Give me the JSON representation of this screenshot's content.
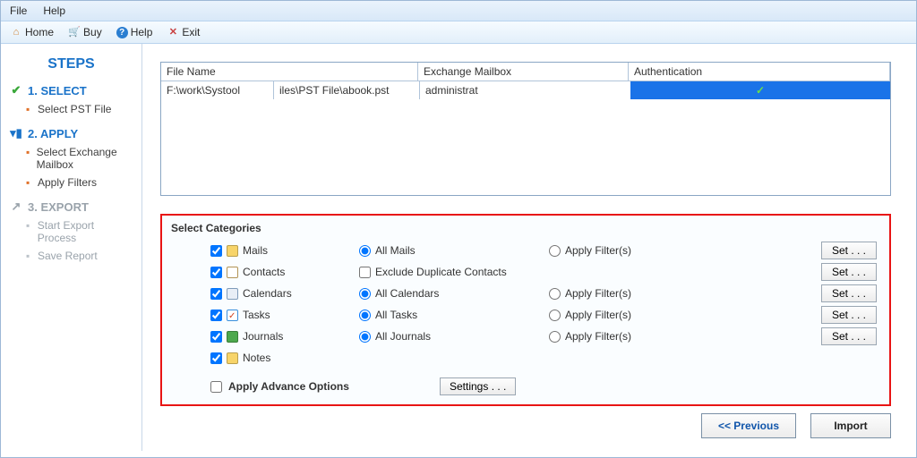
{
  "menu": {
    "file": "File",
    "help": "Help"
  },
  "toolbar": {
    "home": "Home",
    "buy": "Buy",
    "help": "Help",
    "exit": "Exit"
  },
  "sidebar": {
    "title": "STEPS",
    "step1": {
      "heading": "1. SELECT",
      "sub1": "Select PST File"
    },
    "step2": {
      "heading": "2. APPLY",
      "sub1": "Select Exchange Mailbox",
      "sub2": "Apply Filters"
    },
    "step3": {
      "heading": "3. EXPORT",
      "sub1": "Start Export Process",
      "sub2": "Save Report"
    }
  },
  "table": {
    "headers": {
      "filename": "File Name",
      "mailbox": "Exchange Mailbox",
      "auth": "Authentication"
    },
    "rows": [
      {
        "path_a": "F:\\work\\Systool",
        "path_b": "iles\\PST File\\abook.pst",
        "mailbox": "administrat",
        "auth_ok": "✓"
      }
    ]
  },
  "categories": {
    "title": "Select Categories",
    "items": {
      "mails": {
        "label": "Mails",
        "opt_all": "All Mails",
        "opt_filter": "Apply Filter(s)"
      },
      "contacts": {
        "label": "Contacts",
        "opt_exclude": "Exclude Duplicate Contacts"
      },
      "calendars": {
        "label": "Calendars",
        "opt_all": "All Calendars",
        "opt_filter": "Apply Filter(s)"
      },
      "tasks": {
        "label": "Tasks",
        "opt_all": "All Tasks",
        "opt_filter": "Apply Filter(s)"
      },
      "journals": {
        "label": "Journals",
        "opt_all": "All Journals",
        "opt_filter": "Apply Filter(s)"
      },
      "notes": {
        "label": "Notes"
      }
    },
    "set_label": "Set . . .",
    "advance": {
      "label": "Apply Advance Options",
      "settings_btn": "Settings . . ."
    }
  },
  "buttons": {
    "previous": "<< Previous",
    "import": "Import"
  }
}
